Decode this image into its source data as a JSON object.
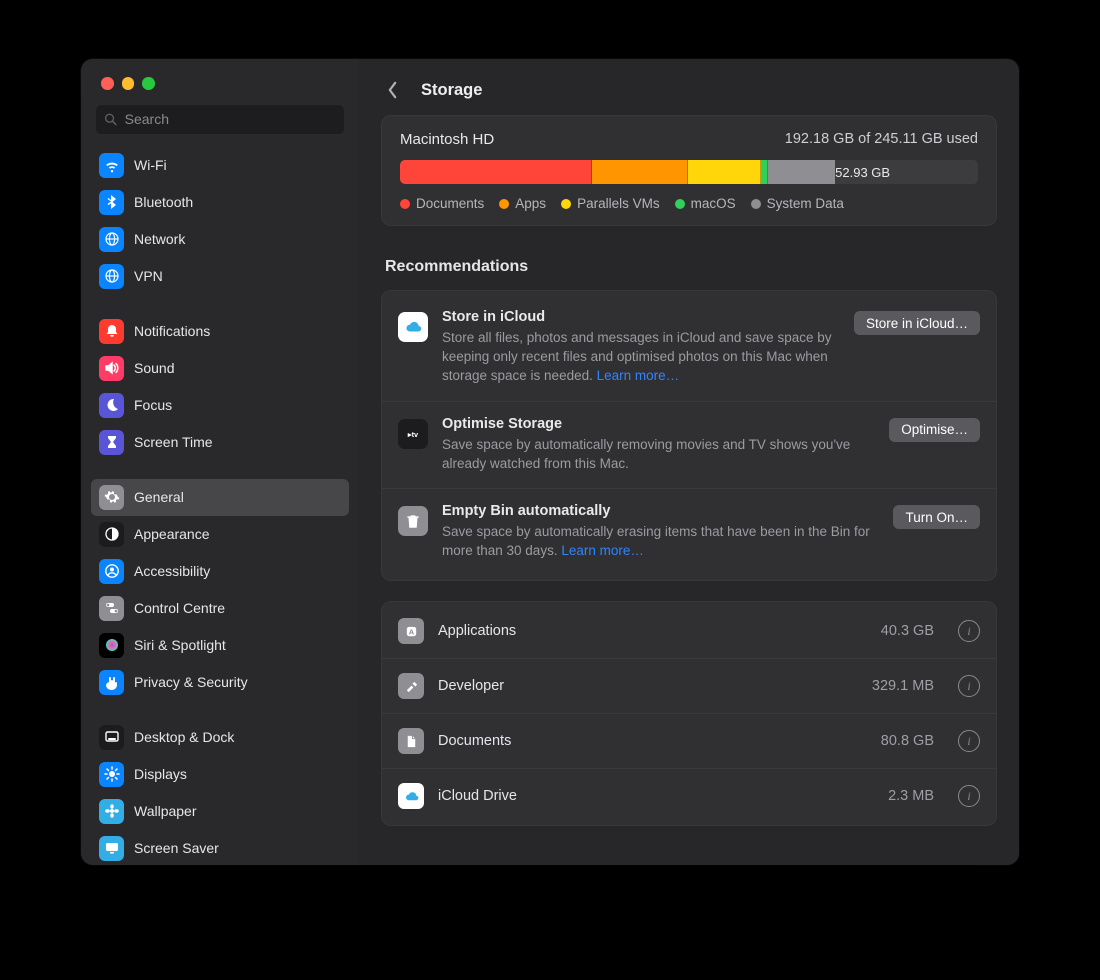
{
  "header": {
    "title": "Storage"
  },
  "sidebar": {
    "search_placeholder": "Search",
    "groups": [
      [
        {
          "label": "Wi-Fi",
          "color": "#0a84ff",
          "icon": "wifi"
        },
        {
          "label": "Bluetooth",
          "color": "#0a84ff",
          "icon": "bluetooth"
        },
        {
          "label": "Network",
          "color": "#0a84ff",
          "icon": "globe"
        },
        {
          "label": "VPN",
          "color": "#0a84ff",
          "icon": "globe"
        }
      ],
      [
        {
          "label": "Notifications",
          "color": "#ff3b30",
          "icon": "bell"
        },
        {
          "label": "Sound",
          "color": "#ff3b66",
          "icon": "speaker"
        },
        {
          "label": "Focus",
          "color": "#5856d6",
          "icon": "moon"
        },
        {
          "label": "Screen Time",
          "color": "#5856d6",
          "icon": "hourglass"
        }
      ],
      [
        {
          "label": "General",
          "color": "#8e8e93",
          "icon": "gear",
          "selected": true
        },
        {
          "label": "Appearance",
          "color": "#1c1c1e",
          "icon": "circle_half"
        },
        {
          "label": "Accessibility",
          "color": "#0a84ff",
          "icon": "person"
        },
        {
          "label": "Control Centre",
          "color": "#8e8e93",
          "icon": "switches"
        },
        {
          "label": "Siri & Spotlight",
          "color": "#000000",
          "icon": "siri"
        },
        {
          "label": "Privacy & Security",
          "color": "#0a84ff",
          "icon": "hand"
        }
      ],
      [
        {
          "label": "Desktop & Dock",
          "color": "#1c1c1e",
          "icon": "dock"
        },
        {
          "label": "Displays",
          "color": "#0a84ff",
          "icon": "sun"
        },
        {
          "label": "Wallpaper",
          "color": "#32ade6",
          "icon": "flower"
        },
        {
          "label": "Screen Saver",
          "color": "#32ade6",
          "icon": "screen"
        }
      ]
    ]
  },
  "storage": {
    "volume": "Macintosh HD",
    "used_text": "192.18 GB of 245.11 GB used",
    "free_text": "52.93 GB",
    "segments": [
      {
        "name": "Documents",
        "color": "#ff443a",
        "pct": 33.0
      },
      {
        "name": "Apps",
        "color": "#ff9500",
        "pct": 16.4
      },
      {
        "name": "Parallels VMs",
        "color": "#ffd60a",
        "pct": 12.5
      },
      {
        "name": "macOS",
        "color": "#30d158",
        "pct": 1.0
      },
      {
        "name": "System Data",
        "color": "#8e8e93",
        "pct": 15.5
      }
    ]
  },
  "recommendations_title": "Recommendations",
  "recommendations": [
    {
      "icon": "cloud",
      "icon_bg": "#ffffff",
      "title": "Store in iCloud",
      "desc": "Store all files, photos and messages in iCloud and save space by keeping only recent files and optimised photos on this Mac when storage space is needed. ",
      "link": "Learn more…",
      "button": "Store in iCloud…"
    },
    {
      "icon": "tv",
      "icon_bg": "#1c1c1e",
      "title": "Optimise Storage",
      "desc": "Save space by automatically removing movies and TV shows you've already watched from this Mac.",
      "link": "",
      "button": "Optimise…"
    },
    {
      "icon": "trash",
      "icon_bg": "#8e8e93",
      "title": "Empty Bin automatically",
      "desc": "Save space by automatically erasing items that have been in the Bin for more than 30 days. ",
      "link": "Learn more…",
      "button": "Turn On…"
    }
  ],
  "categories": [
    {
      "name": "Applications",
      "size": "40.3 GB",
      "icon": "app",
      "bg": "#8e8e93"
    },
    {
      "name": "Developer",
      "size": "329.1 MB",
      "icon": "hammer",
      "bg": "#8e8e93"
    },
    {
      "name": "Documents",
      "size": "80.8 GB",
      "icon": "doc",
      "bg": "#8e8e93"
    },
    {
      "name": "iCloud Drive",
      "size": "2.3 MB",
      "icon": "cloud",
      "bg": "#ffffff"
    }
  ],
  "chart_data": {
    "type": "bar",
    "title": "Macintosh HD storage usage",
    "total_gb": 245.11,
    "used_gb": 192.18,
    "free_gb": 52.93,
    "series": [
      {
        "name": "Documents",
        "gb": 80.8,
        "color": "#ff443a"
      },
      {
        "name": "Apps",
        "gb": 40.3,
        "color": "#ff9500"
      },
      {
        "name": "Parallels VMs",
        "gb": 30.6,
        "color": "#ffd60a"
      },
      {
        "name": "macOS",
        "gb": 2.5,
        "color": "#30d158"
      },
      {
        "name": "System Data",
        "gb": 38.0,
        "color": "#8e8e93"
      }
    ]
  }
}
